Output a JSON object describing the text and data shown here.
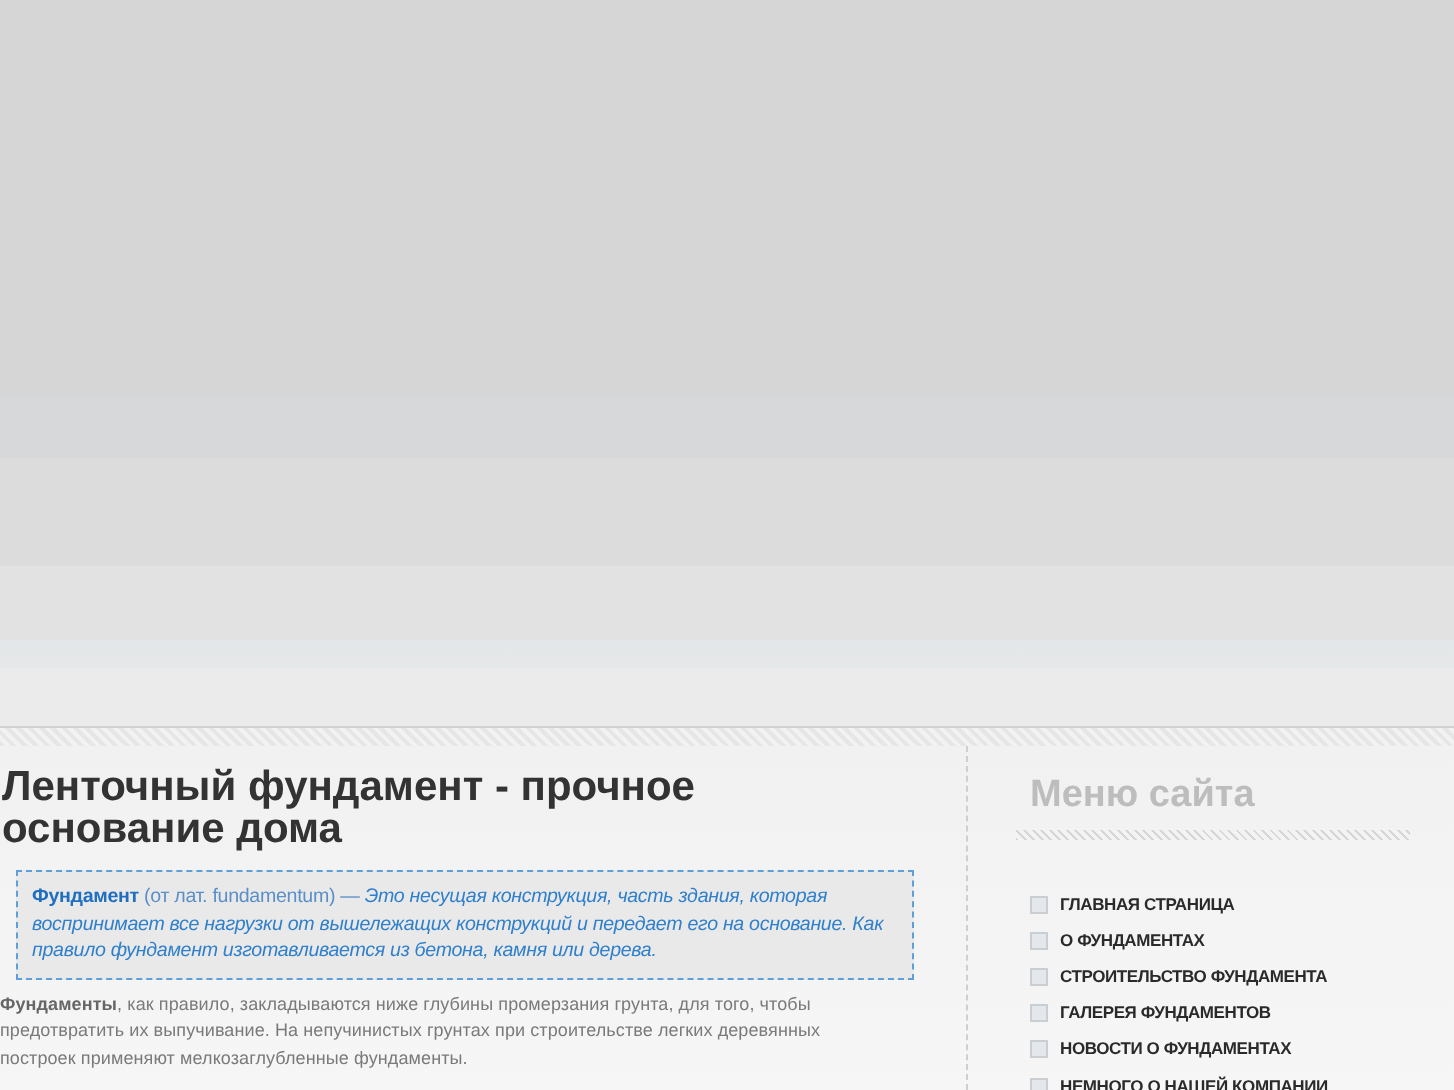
{
  "article": {
    "title": "Ленточный фундамент - прочное основание дома",
    "definition": {
      "term": "Фундамент",
      "origin": "(от лат. fundamentum)  —",
      "text": "Это несущая конструкция, часть здания, которая воспринимает все нагрузки от вышележащих конструкций и передает его на основание. Как правило фундамент изготавливается из бетона, камня или дерева."
    },
    "paragraph": "**Фундаменты**, как правило, закладываются ниже глубины промерзания грунта, для того, чтобы предотвратить их выпучивание. На непучинистых грунтах при строительстве легких деревянных построек применяют мелкозаглубленные фундаменты."
  },
  "sidebar": {
    "title": "Меню сайта",
    "items": [
      {
        "label": "ГЛАВНАЯ СТРАНИЦА"
      },
      {
        "label": "О ФУНДАМЕНТАХ"
      },
      {
        "label": "СТРОИТЕЛЬСТВО ФУНДАМЕНТА"
      },
      {
        "label": "ГАЛЕРЕЯ ФУНДАМЕНТОВ"
      },
      {
        "label": "НОВОСТИ О ФУНДАМЕНТАХ"
      },
      {
        "label": "НЕМНОГО О НАШЕЙ КОМПАНИИ"
      }
    ]
  }
}
